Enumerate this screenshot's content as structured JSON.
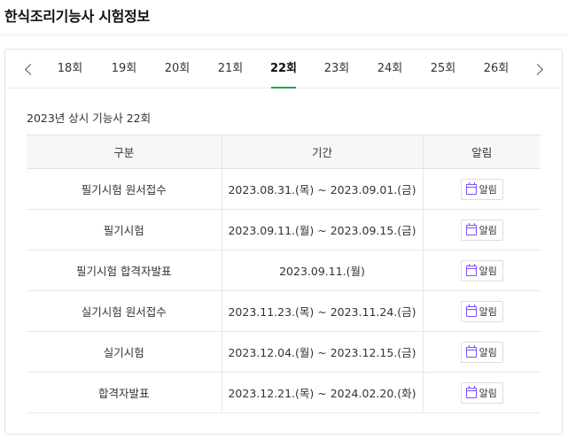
{
  "header": {
    "title": "한식조리기능사 시험정보"
  },
  "tabs": [
    {
      "label": "18회"
    },
    {
      "label": "19회"
    },
    {
      "label": "20회"
    },
    {
      "label": "21회"
    },
    {
      "label": "22회"
    },
    {
      "label": "23회"
    },
    {
      "label": "24회"
    },
    {
      "label": "25회"
    },
    {
      "label": "26회"
    }
  ],
  "active_tab": "22회",
  "section": {
    "title": "2023년 상시 기능사 22회"
  },
  "table": {
    "headers": {
      "category": "구분",
      "period": "기간",
      "alarm": "알림"
    },
    "alarm_label": "알림",
    "rows": [
      {
        "category": "필기시험 원서접수",
        "period": "2023.08.31.(목) ~ 2023.09.01.(금)"
      },
      {
        "category": "필기시험",
        "period": "2023.09.11.(월) ~ 2023.09.15.(금)"
      },
      {
        "category": "필기시험 합격자발표",
        "period": "2023.09.11.(월)"
      },
      {
        "category": "실기시험 원서접수",
        "period": "2023.11.23.(목) ~ 2023.11.24.(금)"
      },
      {
        "category": "실기시험",
        "period": "2023.12.04.(월) ~ 2023.12.15.(금)"
      },
      {
        "category": "합격자발표",
        "period": "2023.12.21.(목) ~ 2024.02.20.(화)"
      }
    ]
  },
  "colors": {
    "accent": "#1aa94d",
    "calendar_icon": "#7c4dff"
  }
}
